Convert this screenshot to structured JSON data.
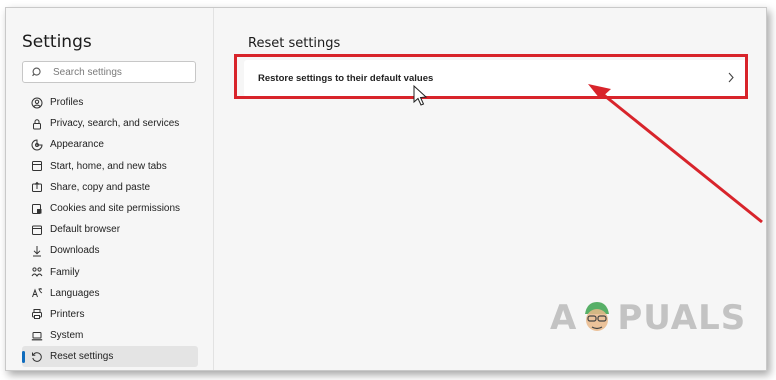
{
  "sidebar": {
    "title": "Settings",
    "search_placeholder": "Search settings",
    "items": [
      {
        "label": "Profiles",
        "icon": "profile-icon"
      },
      {
        "label": "Privacy, search, and services",
        "icon": "lock-icon"
      },
      {
        "label": "Appearance",
        "icon": "appearance-icon"
      },
      {
        "label": "Start, home, and new tabs",
        "icon": "start-icon"
      },
      {
        "label": "Share, copy and paste",
        "icon": "share-icon"
      },
      {
        "label": "Cookies and site permissions",
        "icon": "cookies-icon"
      },
      {
        "label": "Default browser",
        "icon": "browser-icon"
      },
      {
        "label": "Downloads",
        "icon": "download-icon"
      },
      {
        "label": "Family",
        "icon": "family-icon"
      },
      {
        "label": "Languages",
        "icon": "languages-icon"
      },
      {
        "label": "Printers",
        "icon": "printer-icon"
      },
      {
        "label": "System",
        "icon": "system-icon"
      },
      {
        "label": "Reset settings",
        "icon": "reset-icon",
        "active": true
      }
    ]
  },
  "main": {
    "title": "Reset settings",
    "restore_label": "Restore settings to their default values"
  },
  "watermark": {
    "left": "A",
    "right": "PUALS"
  },
  "colors": {
    "accent": "#0f6cbd",
    "highlight": "#d8242b"
  }
}
